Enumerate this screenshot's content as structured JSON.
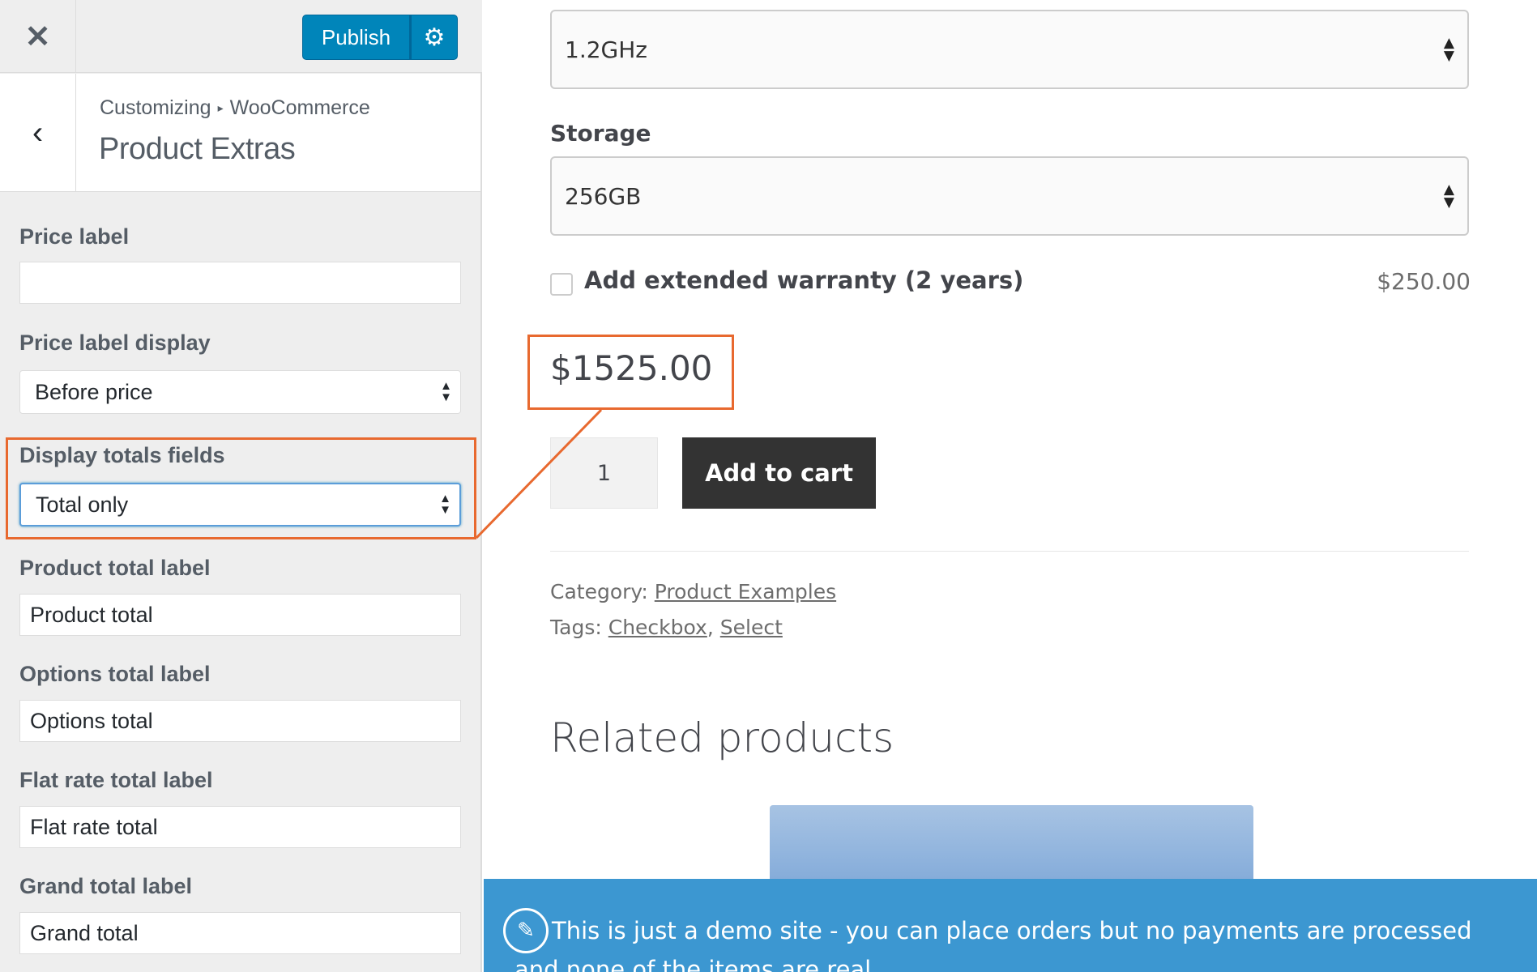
{
  "topbar": {
    "close_icon": "close-icon",
    "publish_label": "Publish",
    "settings_icon": "gear-icon"
  },
  "section": {
    "breadcrumb_root": "Customizing",
    "breadcrumb_separator": "▸",
    "breadcrumb_current": "WooCommerce",
    "title": "Product Extras",
    "back_icon": "chevron-left-icon"
  },
  "fields": {
    "price_label": {
      "label": "Price label",
      "value": ""
    },
    "price_label_display": {
      "label": "Price label display",
      "selected": "Before price"
    },
    "display_totals_fields": {
      "label": "Display totals fields",
      "selected": "Total only"
    },
    "product_total_label": {
      "label": "Product total label",
      "value": "Product total"
    },
    "options_total_label": {
      "label": "Options total label",
      "value": "Options total"
    },
    "flat_rate_total_label": {
      "label": "Flat rate total label",
      "value": "Flat rate total"
    },
    "grand_total_label": {
      "label": "Grand total label",
      "value": "Grand total"
    }
  },
  "preview": {
    "processor_selected": "1.2GHz",
    "storage_label": "Storage",
    "storage_selected": "256GB",
    "warranty_label": "Add extended warranty (2 years)",
    "warranty_price": "$250.00",
    "price": "$1525.00",
    "quantity": "1",
    "add_to_cart": "Add to cart",
    "category_label": "Category:",
    "category_link": "Product Examples",
    "tags_label": "Tags:",
    "tag_1": "Checkbox",
    "tag_sep": ",",
    "tag_2": "Select",
    "related_title": "Related products",
    "demo_notice": "This is just a demo site - you can place orders but no payments are processed and none of the items are real..."
  },
  "colors": {
    "accent_blue": "#0085ba",
    "highlight_orange": "#e8692f",
    "demo_bar": "#3c97d1",
    "button_dark": "#333333"
  }
}
